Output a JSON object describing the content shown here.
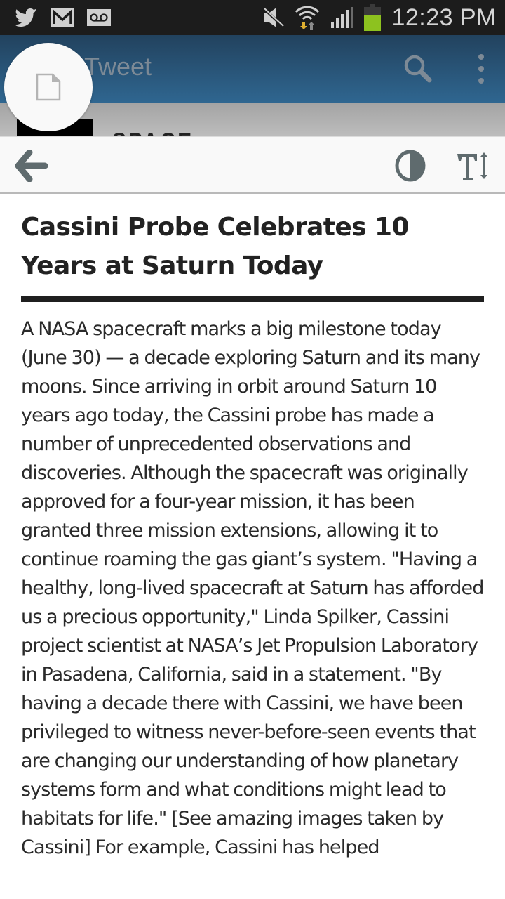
{
  "status_bar": {
    "notification_icons": [
      "twitter-icon",
      "gmail-icon",
      "voicemail-icon"
    ],
    "system_icons": [
      "mute-icon",
      "wifi-icon",
      "signal-icon",
      "battery-icon"
    ],
    "time": "12:23 PM",
    "battery_color": "#8dc21f"
  },
  "app_bar": {
    "title": "Tweet",
    "behind_text": "SPACE",
    "colors": {
      "top": "#22425e",
      "bottom": "#2f6690"
    }
  },
  "fab": {
    "icon": "document-icon"
  },
  "reader_toolbar": {
    "back_icon": "back-arrow-icon",
    "contrast_icon": "contrast-icon",
    "text_size_icon": "text-size-icon"
  },
  "article": {
    "title": "Cassini Probe Celebrates 10 Years at Saturn Today",
    "body": "A NASA spacecraft marks a big milestone today (June 30) — a decade exploring Saturn and its many moons. Since arriving in orbit around Saturn 10 years ago today, the Cassini probe has made a number of unprecedented observations and discoveries. Although the spacecraft was originally approved for a four-year mission, it has been granted three mission extensions, allowing it to continue roaming the gas giant’s system. \"Having a healthy, long-lived spacecraft at Saturn has afforded us a precious opportunity,\" Linda Spilker, Cassini project scientist at NASA’s Jet Propulsion Laboratory in Pasadena, California, said in a statement. \"By having a decade there with Cassini, we have been privileged to witness never-before-seen events that are changing our understanding of how planetary systems form and what conditions might lead to habitats for life.\" [See amazing images taken by Cassini] For example, Cassini has helped"
  }
}
